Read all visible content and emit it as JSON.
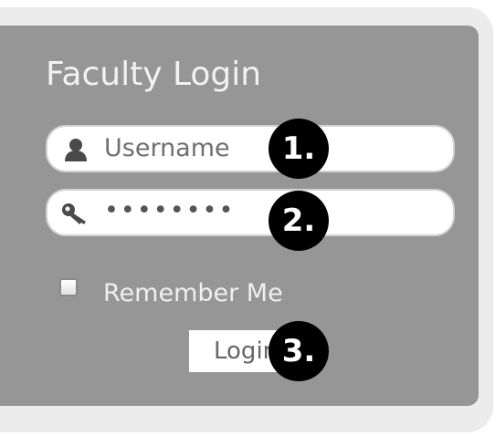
{
  "login_panel": {
    "title": "Faculty Login",
    "username": {
      "placeholder": "Username",
      "icon": "user-icon"
    },
    "password": {
      "value": "••••••••",
      "icon": "key-icon"
    },
    "remember_me": {
      "label": "Remember Me",
      "checked": false
    },
    "login_button": {
      "label": "Login"
    }
  },
  "annotations": {
    "marker_1": "1.",
    "marker_2": "2.",
    "marker_3": "3."
  },
  "colors": {
    "panel_background": "#969696",
    "field_background": "#ffffff",
    "title_text": "#f2f2f2",
    "marker_background": "#000000"
  }
}
